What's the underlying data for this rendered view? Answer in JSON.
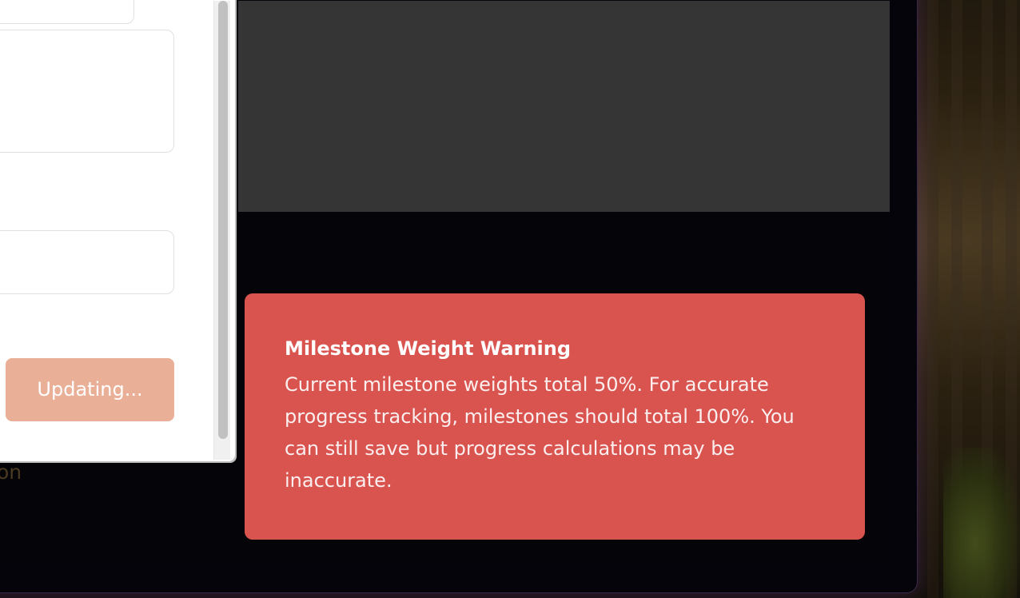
{
  "background_caption": "ion",
  "dialog": {
    "update_button_label": "Updating..."
  },
  "toast": {
    "title": "Milestone Weight Warning",
    "message": "Current milestone weights total 50%. For accurate progress tracking, milestones should total 100%. You can still save but progress calculations may be inaccurate."
  },
  "colors": {
    "toast_background": "#d9534f",
    "update_button": "#e9b097",
    "dark_panel": "#353535"
  }
}
